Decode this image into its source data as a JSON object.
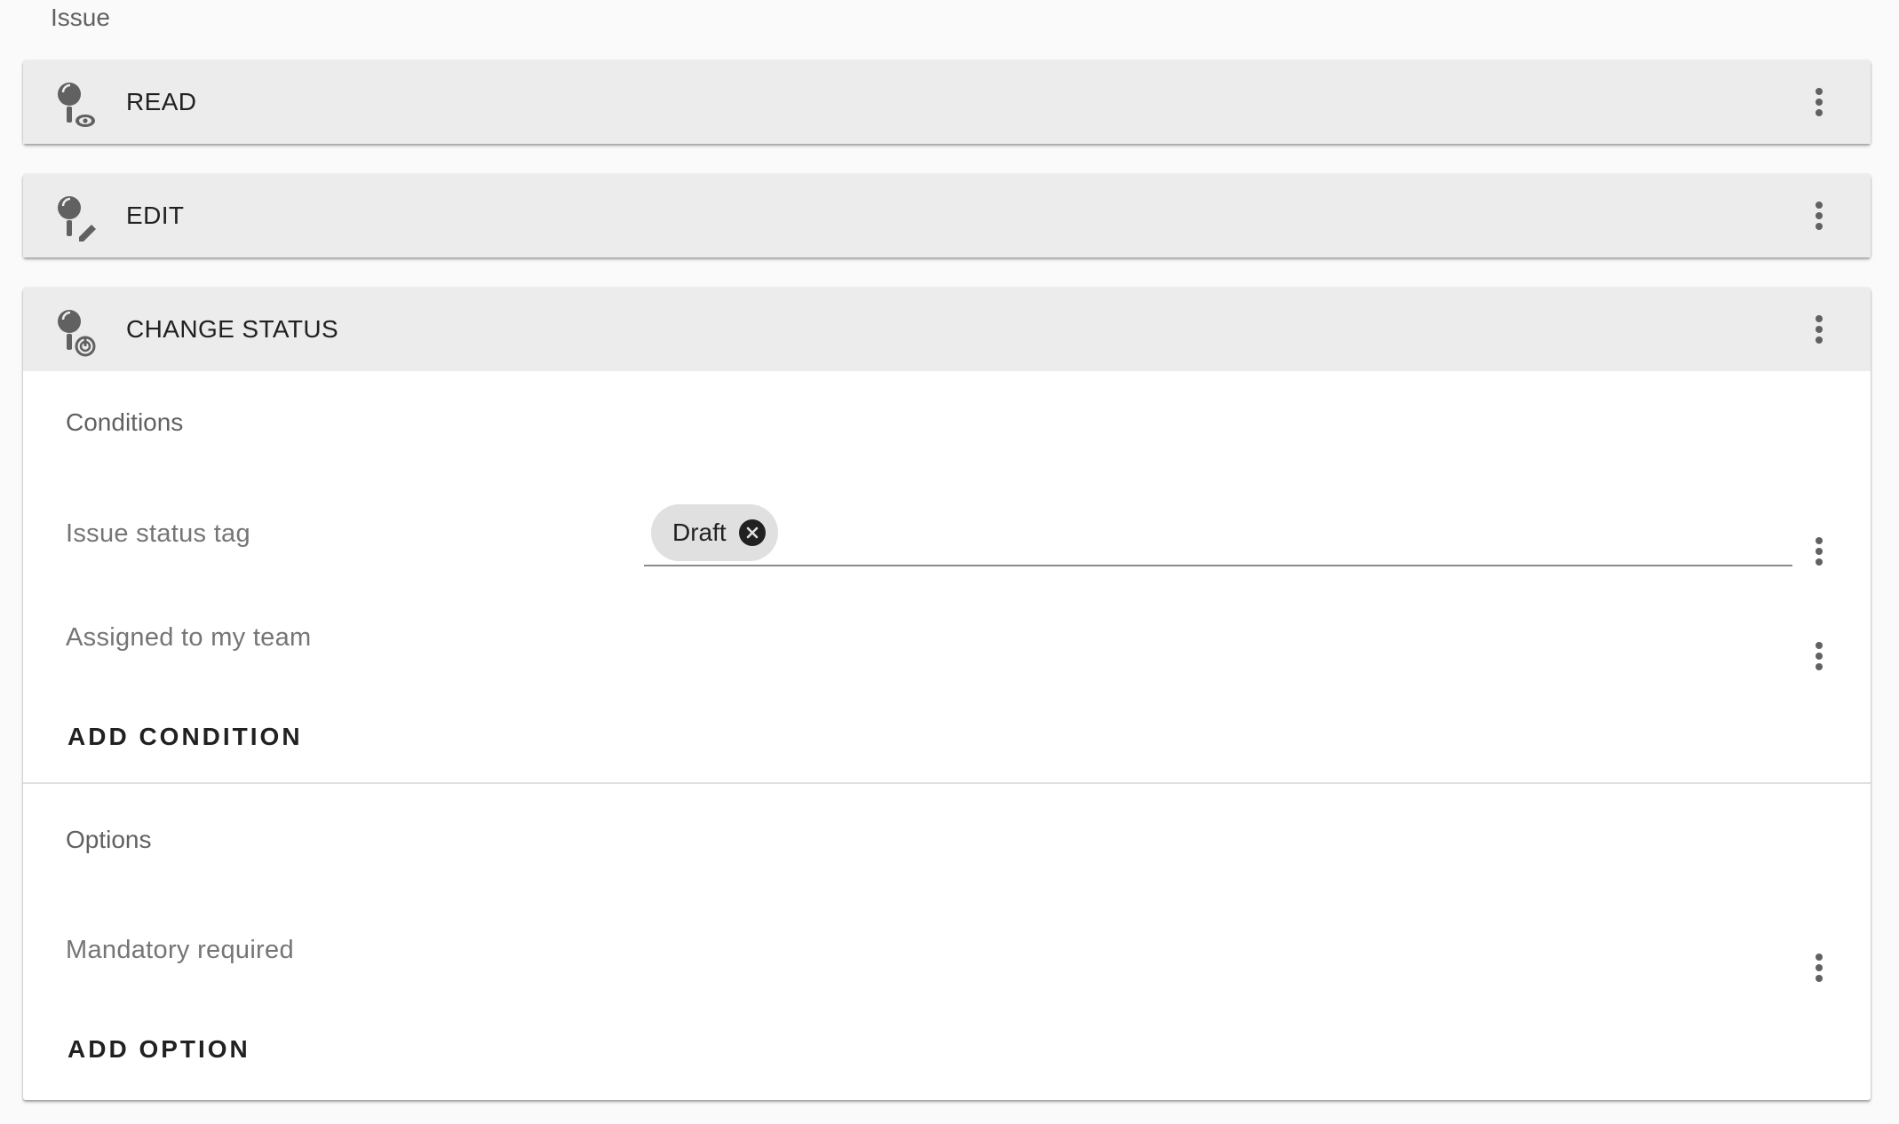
{
  "section_label": "Issue",
  "panels": [
    {
      "title": "READ",
      "icon": "key-view-icon"
    },
    {
      "title": "EDIT",
      "icon": "key-edit-icon"
    },
    {
      "title": "CHANGE STATUS",
      "icon": "key-status-icon"
    }
  ],
  "change_status": {
    "conditions": {
      "title": "Conditions",
      "rows": [
        {
          "label": "Issue status tag",
          "chips": [
            "Draft"
          ]
        },
        {
          "label": "Assigned to my team"
        }
      ],
      "add_label": "ADD CONDITION"
    },
    "options": {
      "title": "Options",
      "rows": [
        {
          "label": "Mandatory required"
        }
      ],
      "add_label": "ADD OPTION"
    }
  },
  "colors": {
    "header_bg": "#ececec",
    "icon_gray": "#616161",
    "chip_bg": "#e0e0e0",
    "text_dark": "#212121",
    "text_muted": "#757575"
  }
}
